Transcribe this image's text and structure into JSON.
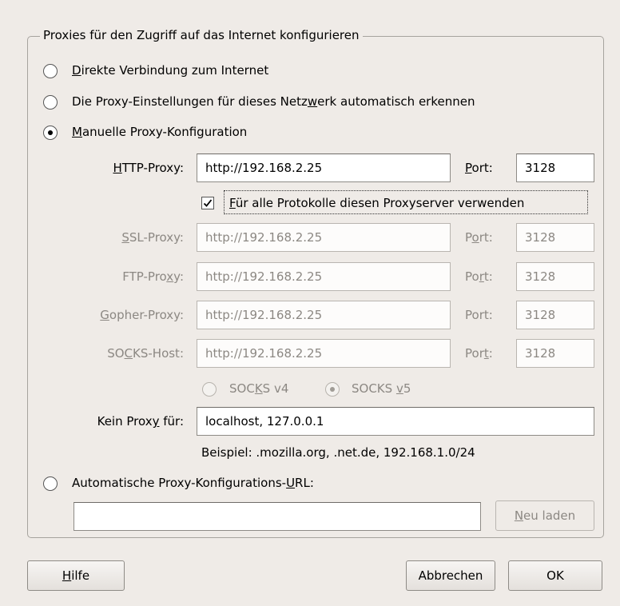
{
  "group_title": "Proxies für den Zugriff auf das Internet konfigurieren",
  "options": {
    "direct": {
      "pre": "",
      "ul": "D",
      "post": "irekte Verbindung zum Internet"
    },
    "auto_detect": {
      "pre": "Die Proxy-Einstellungen für dieses Netz",
      "ul": "w",
      "post": "erk automatisch erkennen"
    },
    "manual": {
      "pre": "",
      "ul": "M",
      "post": "anuelle Proxy-Konfiguration"
    },
    "auto_url": {
      "pre": "Automatische Proxy-Konfigurations-",
      "ul": "U",
      "post": "RL:"
    }
  },
  "http": {
    "label_ul": "H",
    "label_post": "TTP-Proxy:",
    "value": "http://192.168.2.25",
    "port_ul": "P",
    "port_post": "ort:",
    "port": "3128"
  },
  "share_all": {
    "pre": "",
    "ul": "F",
    "post": "ür alle Protokolle diesen Proxyserver verwenden",
    "checked": true
  },
  "ssl": {
    "label_pre": "",
    "label_ul": "S",
    "label_post": "SL-Proxy:",
    "value": "http://192.168.2.25",
    "port_pre": "P",
    "port_ul": "o",
    "port_post": "rt:",
    "port": "3128"
  },
  "ftp": {
    "label_pre": "FTP-Pro",
    "label_ul": "x",
    "label_post": "y:",
    "value": "http://192.168.2.25",
    "port_pre": "Po",
    "port_ul": "r",
    "port_post": "t:",
    "port": "3128"
  },
  "gopher": {
    "label_pre": "",
    "label_ul": "G",
    "label_post": "opher-Proxy:",
    "value": "http://192.168.2.25",
    "port_label": "Port:",
    "port": "3128"
  },
  "socks": {
    "label_pre": "SO",
    "label_ul": "C",
    "label_post": "KS-Host:",
    "value": "http://192.168.2.25",
    "port_pre": "Por",
    "port_ul": "t",
    "port_post": ":",
    "port": "3128"
  },
  "socks_v4": {
    "pre": "SOC",
    "ul": "K",
    "post": "S v4"
  },
  "socks_v5": {
    "pre": "SOCKS ",
    "ul": "v",
    "post": "5"
  },
  "no_proxy": {
    "label_pre": "Kein Prox",
    "label_ul": "y",
    "label_post": " für:",
    "value": "localhost, 127.0.0.1"
  },
  "example": "Beispiel: .mozilla.org, .net.de, 192.168.1.0/24",
  "auto_url_value": "",
  "reload": {
    "ul": "N",
    "post": "eu laden"
  },
  "buttons": {
    "help": {
      "ul": "H",
      "post": "ilfe"
    },
    "cancel": "Abbrechen",
    "ok": "OK"
  }
}
